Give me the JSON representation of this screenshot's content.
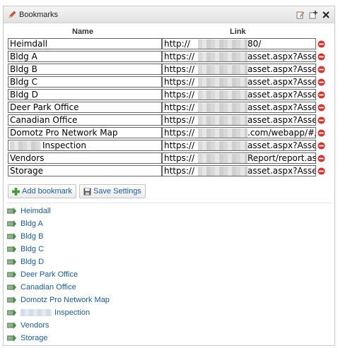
{
  "window": {
    "title": "Bookmarks"
  },
  "table": {
    "headers": {
      "name": "Name",
      "link": "Link"
    },
    "rows": [
      {
        "name": "Heimdall",
        "link_start": "http://",
        "link_end": "80/"
      },
      {
        "name": "Bldg A",
        "link_start": "https://",
        "link_end": "asset.aspx?AssetI"
      },
      {
        "name": "Bldg B",
        "link_start": "https://",
        "link_end": "asset.aspx?AssetI"
      },
      {
        "name": "Bldg C",
        "link_start": "https://",
        "link_end": "asset.aspx?AssetI"
      },
      {
        "name": "Bldg D",
        "link_start": "https://",
        "link_end": "asset.aspx?AssetI"
      },
      {
        "name": "Deer Park Office",
        "link_start": "https://",
        "link_end": "asset.aspx?AssetI"
      },
      {
        "name": "Canadian Office",
        "link_start": "https://",
        "link_end": "asset.aspx?AssetI"
      },
      {
        "name": "Domotz Pro Network Map",
        "link_start": "https://",
        "link_end": ".com/webapp/#/("
      },
      {
        "name": "Inspection",
        "link_start": "https://",
        "link_end": "asset.aspx?AssetI"
      },
      {
        "name": "Vendors",
        "link_start": "https://",
        "link_end": "Report/report.asp"
      },
      {
        "name": "Storage",
        "link_start": "https://",
        "link_end": "asset.aspx?AssetI"
      }
    ]
  },
  "buttons": {
    "add_bookmark": "Add bookmark",
    "save_settings": "Save Settings"
  },
  "links": [
    "Heimdall",
    "Bldg A",
    "Bldg B",
    "Bldg C",
    "Bldg D",
    "Deer Park Office",
    "Canadian Office",
    "Domotz Pro Network Map",
    "Inspection",
    "Vendors",
    "Storage"
  ],
  "colors": {
    "link": "#1a5c9e",
    "delete": "#d9342b",
    "add": "#3fa03a"
  },
  "icons": [
    "pencil-icon",
    "edit-icon",
    "add-window-icon",
    "close-icon",
    "delete-icon",
    "plus-icon",
    "floppy-icon",
    "bookmark-link-icon"
  ]
}
